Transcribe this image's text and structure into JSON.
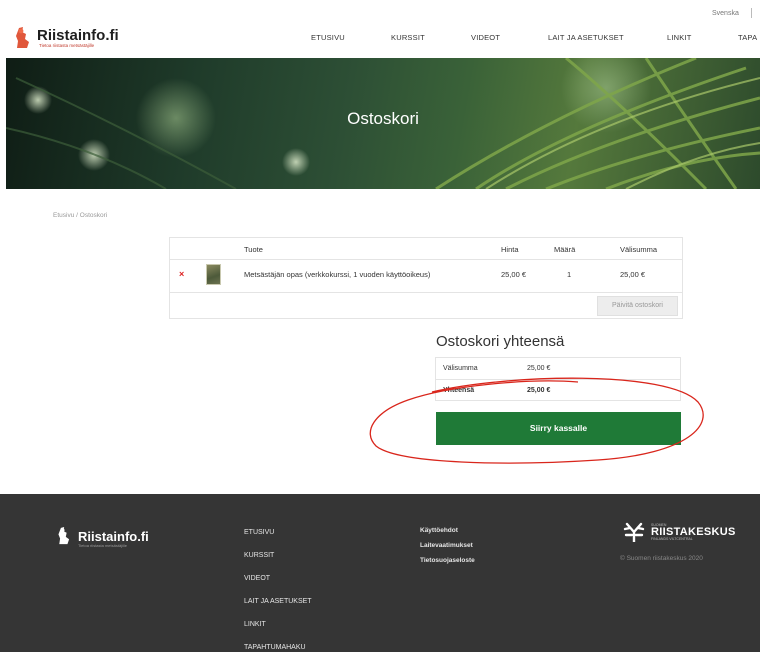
{
  "header": {
    "language": "Svenska",
    "logo_name": "Riistainfo.fi",
    "logo_tagline": "Tietoa riistasta metsästäjille",
    "nav": [
      "ETUSIVU",
      "KURSSIT",
      "VIDEOT",
      "LAIT JA ASETUKSET",
      "LINKIT",
      "TAPA"
    ]
  },
  "hero": {
    "title": "Ostoskori"
  },
  "breadcrumb": {
    "home": "Etusivu",
    "separator": "/",
    "current": "Ostoskori"
  },
  "cart": {
    "headers": {
      "product": "Tuote",
      "price": "Hinta",
      "quantity": "Määrä",
      "subtotal": "Välisumma"
    },
    "items": [
      {
        "remove": "×",
        "name": "Metsästäjän opas (verkkokurssi, 1 vuoden käyttöoikeus)",
        "price": "25,00 €",
        "quantity": "1",
        "subtotal": "25,00 €"
      }
    ],
    "update_button": "Päivitä ostoskori"
  },
  "totals": {
    "title": "Ostoskori yhteensä",
    "subtotal_label": "Välisumma",
    "subtotal_value": "25,00 €",
    "total_label": "Yhteensä",
    "total_value": "25,00 €",
    "checkout_button": "Siirry kassalle"
  },
  "footer": {
    "logo_name": "Riistainfo.fi",
    "logo_tagline": "Tietoa riistasta metsästäjille",
    "nav": [
      "ETUSIVU",
      "KURSSIT",
      "VIDEOT",
      "LAIT JA ASETUKSET",
      "LINKIT",
      "TAPAHTUMAHAKU"
    ],
    "links": [
      "Käyttöehdot",
      "Laitevaatimukset",
      "Tietosuojaseloste"
    ],
    "partner_name": "RIISTAKESKUS",
    "partner_small_top": "SUOMEN",
    "partner_small_bottom": "FINLANDS VILTCENTRAL",
    "copyright": "© Suomen riistakeskus 2020"
  },
  "colors": {
    "accent": "#1f7a37",
    "link": "#2e7d32",
    "remove": "#dd2222",
    "annotation": "#d9261c",
    "footer_bg": "#353535"
  }
}
